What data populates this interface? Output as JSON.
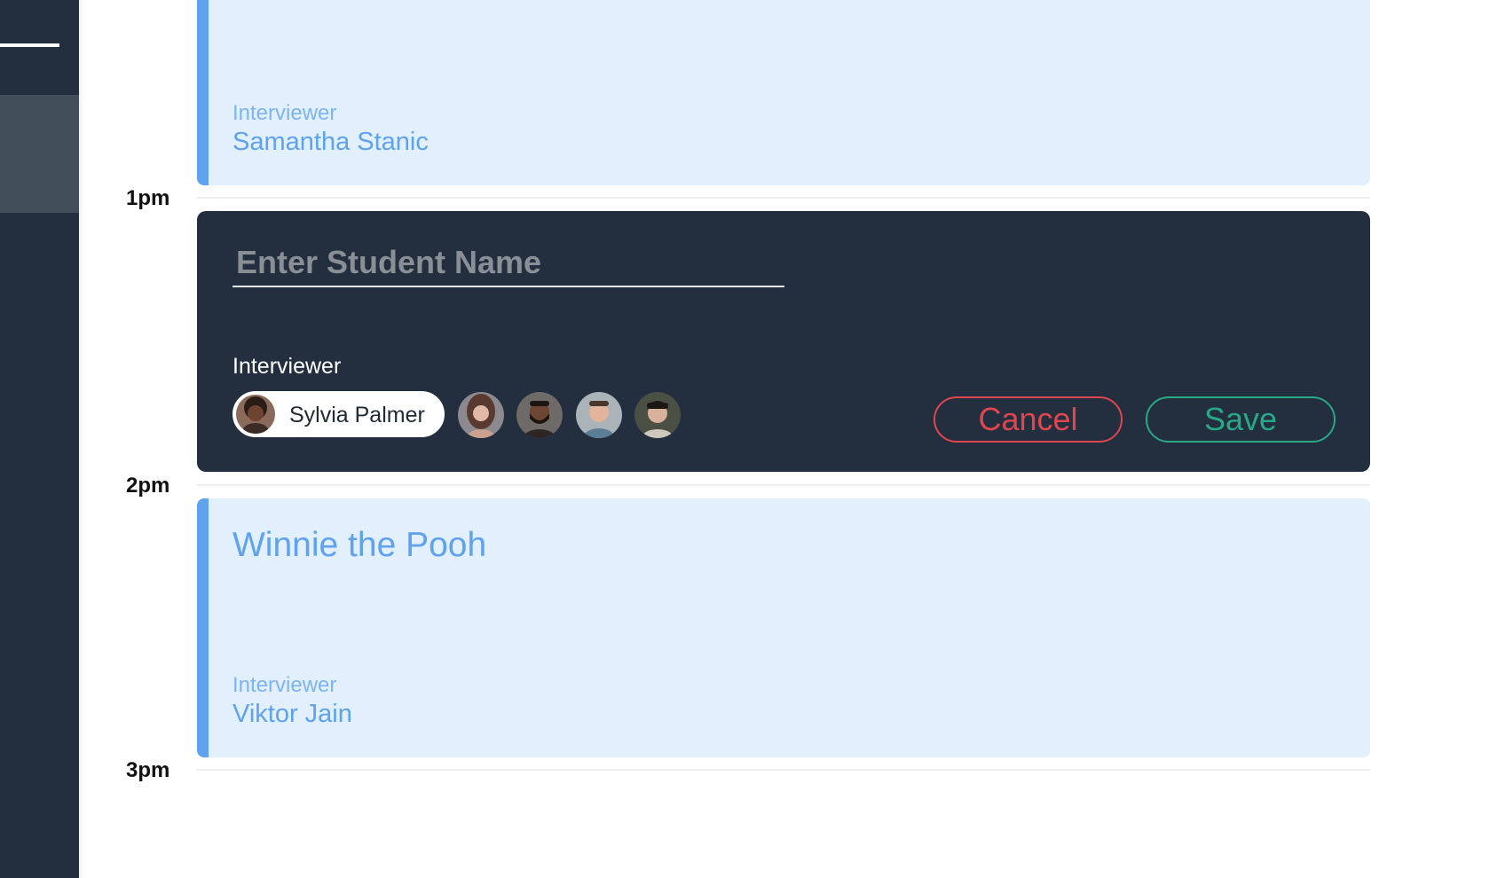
{
  "schedule": {
    "time_labels": [
      "1pm",
      "2pm",
      "3pm"
    ],
    "events": [
      {
        "title": "",
        "interviewer_label": "Interviewer",
        "interviewer_name": "Samantha Stanic"
      },
      {
        "title": "Winnie the Pooh",
        "interviewer_label": "Interviewer",
        "interviewer_name": "Viktor Jain"
      }
    ]
  },
  "editor": {
    "student_input_value": "",
    "student_input_placeholder": "Enter Student Name",
    "interviewer_label": "Interviewer",
    "selected_interviewer": "Sylvia Palmer",
    "other_interviewer_avatars": [
      "avatar-woman-long-hair",
      "avatar-man-beard",
      "avatar-man-smiling",
      "avatar-man-dark-hair"
    ],
    "cancel_label": "Cancel",
    "save_label": "Save"
  },
  "colors": {
    "sidebar": "#232e3e",
    "event_background": "#e2effd",
    "event_accent": "#5ea2f0",
    "editor_background": "#232e3e",
    "cancel": "#e0464f",
    "save": "#27a886"
  }
}
